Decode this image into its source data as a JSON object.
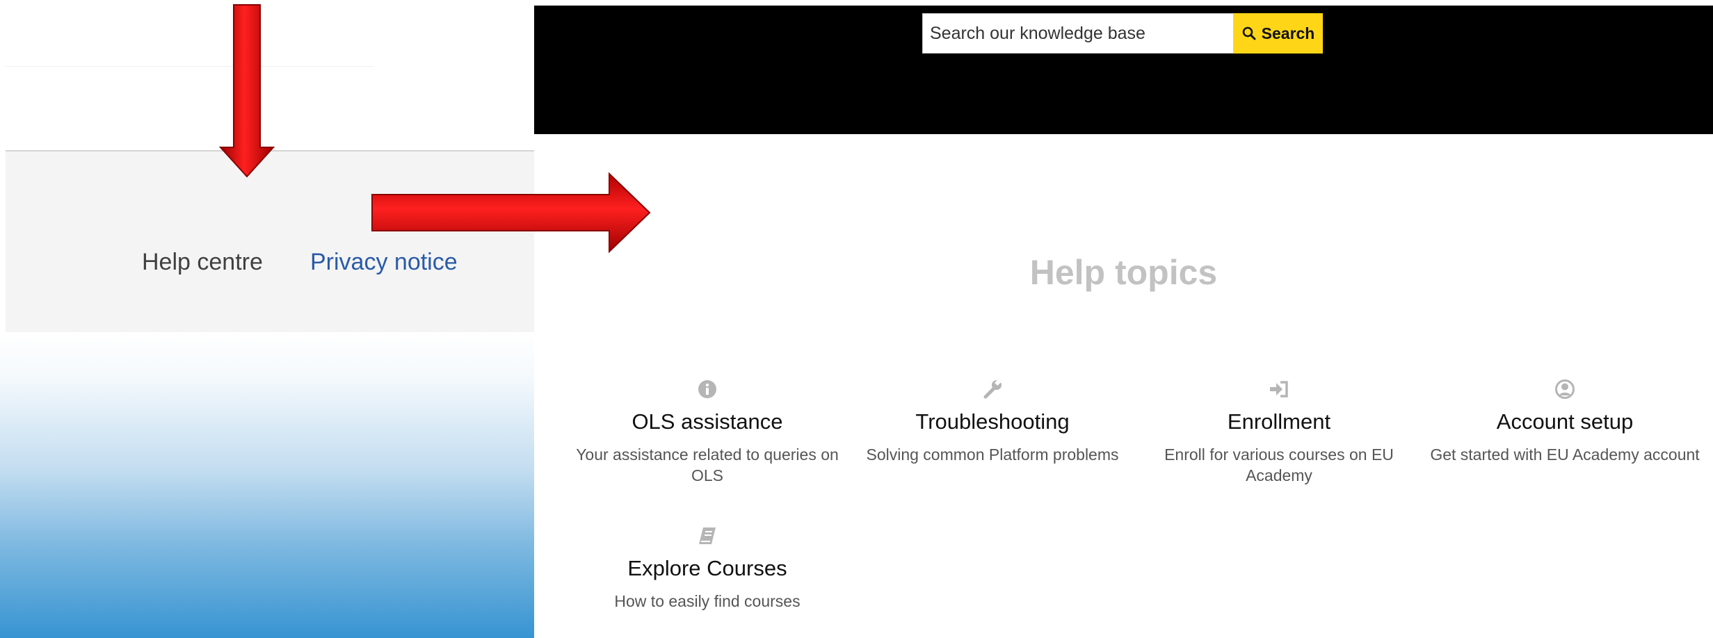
{
  "footer": {
    "help_centre": "Help centre",
    "privacy_notice": "Privacy notice"
  },
  "search": {
    "placeholder": "Search our knowledge base",
    "button_label": "Search"
  },
  "help_topics": {
    "title": "Help topics",
    "items": [
      {
        "icon": "info-circle-icon",
        "title": "OLS assistance",
        "desc": "Your assistance related to queries on OLS"
      },
      {
        "icon": "wrench-icon",
        "title": "Troubleshooting",
        "desc": "Solving common Platform problems"
      },
      {
        "icon": "sign-in-icon",
        "title": "Enrollment",
        "desc": "Enroll for various courses on EU Academy"
      },
      {
        "icon": "user-circle-icon",
        "title": "Account setup",
        "desc": "Get started with EU Academy account"
      },
      {
        "icon": "book-icon",
        "title": "Explore Courses",
        "desc": "How to easily find courses"
      }
    ]
  },
  "colors": {
    "header_bg": "#000000",
    "search_button_bg": "#ffd617",
    "arrow_red": "#e00000",
    "privacy_link": "#2a5aa8",
    "help_title": "#c2c2c2",
    "icon_gray": "#b5b5b5"
  }
}
